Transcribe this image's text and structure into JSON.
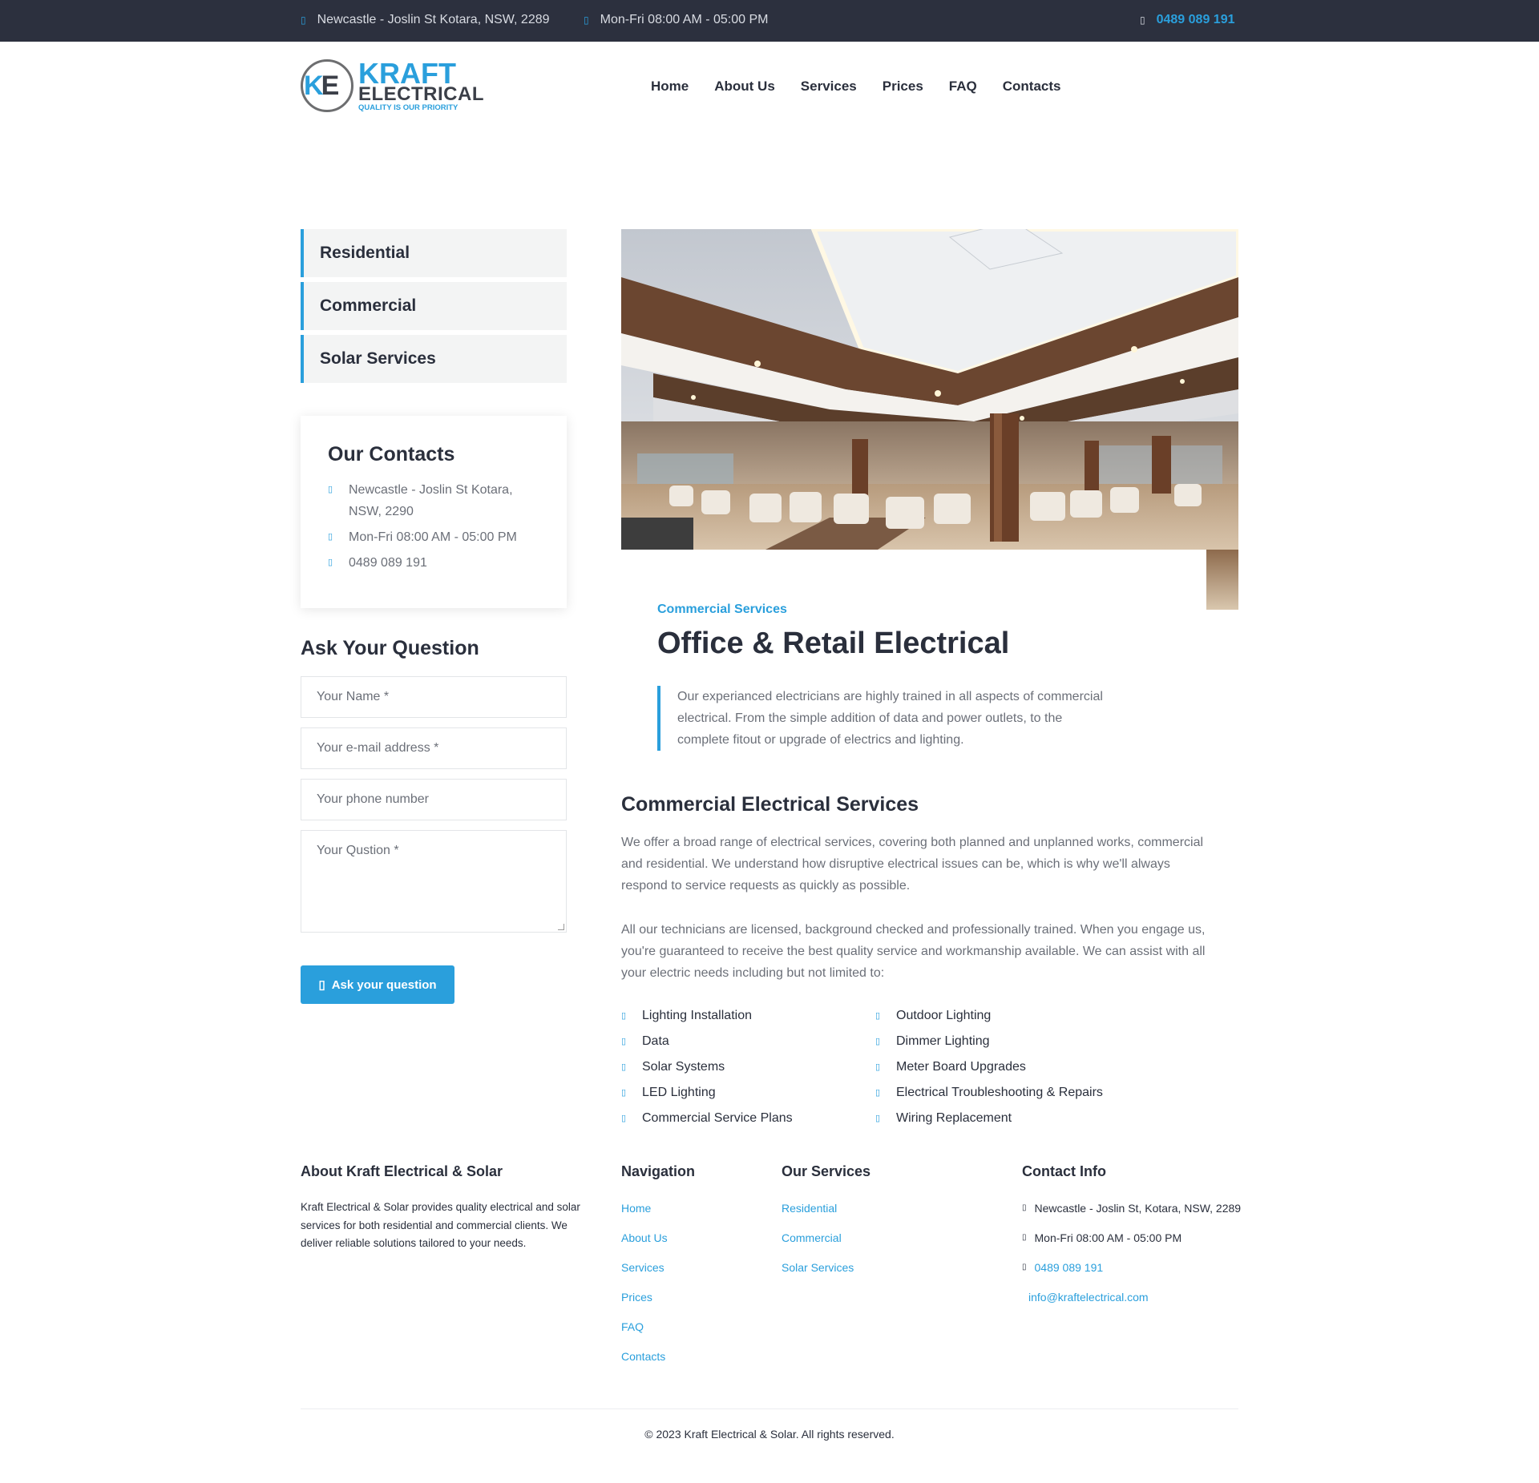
{
  "topbar": {
    "address": "Newcastle - Joslin St Kotara, NSW, 2289",
    "hours": "Mon-Fri 08:00 AM - 05:00 PM",
    "phone": "0489 089 191",
    "address_icon": "map-marker-icon",
    "hours_icon": "clock-icon",
    "phone_icon": "phone-icon"
  },
  "logo": {
    "brand": "KRAFT",
    "sub": "ELECTRICAL",
    "tagline": "QUALITY IS OUR PRIORITY",
    "monogram": "KE"
  },
  "nav": {
    "items": [
      "Home",
      "About Us",
      "Services",
      "Prices",
      "FAQ",
      "Contacts"
    ]
  },
  "sidebar": {
    "items": [
      "Residential",
      "Commercial",
      "Solar Services"
    ],
    "contacts": {
      "title": "Our Contacts",
      "address": "Newcastle - Joslin St Kotara, NSW, 2290",
      "hours": "Mon-Fri 08:00 AM - 05:00 PM",
      "phone": "0489 089 191"
    },
    "form": {
      "title": "Ask Your Question",
      "name_placeholder": "Your Name *",
      "email_placeholder": "Your e-mail address *",
      "phone_placeholder": "Your phone number",
      "question_placeholder": "Your Qustion *",
      "button": "Ask your question"
    }
  },
  "main": {
    "category": "Commercial Services",
    "title": "Office & Retail Electrical",
    "quote": "Our experianced electricians are highly trained in all aspects of commercial electrical. From the simple addition of data and power outlets, to the complete fitout or upgrade of electrics and lighting.",
    "section_title": "Commercial Electrical Services",
    "para1": "We offer a broad range of electrical services, covering both planned and unplanned works, commercial and residential. We understand how disruptive electrical issues can be, which is why we'll always respond to service requests as quickly as possible.",
    "para2": "All our technicians are licensed, background checked and professionally trained. When you engage us, you're guaranteed to receive the best quality service and workmanship available. We can assist with all your electric needs including but not limited to:",
    "services_left": [
      "Lighting Installation",
      "Data",
      "Solar Systems",
      "LED Lighting",
      "Commercial Service Plans"
    ],
    "services_right": [
      "Outdoor Lighting",
      "Dimmer Lighting",
      "Meter Board Upgrades",
      "Electrical Troubleshooting & Repairs",
      "Wiring Replacement"
    ]
  },
  "footer": {
    "about_title": "About Kraft Electrical & Solar",
    "about_text": "Kraft Electrical & Solar provides quality electrical and solar services for both residential and commercial clients. We deliver reliable solutions tailored to your needs.",
    "nav_title": "Navigation",
    "nav_links": [
      "Home",
      "About Us",
      "Services",
      "Prices",
      "FAQ",
      "Contacts"
    ],
    "services_title": "Our Services",
    "service_links": [
      "Residential",
      "Commercial",
      "Solar Services"
    ],
    "contact_title": "Contact Info",
    "contact_address": "Newcastle - Joslin St, Kotara, NSW, 2289",
    "contact_hours": "Mon-Fri 08:00 AM - 05:00 PM",
    "contact_phone": "0489 089 191",
    "contact_email": "info@kraftelectrical.com",
    "copyright": "© 2023 Kraft Electrical & Solar. All rights reserved."
  },
  "colors": {
    "accent": "#2a9fdc",
    "dark": "#2c303e",
    "text": "#2a2f3c",
    "muted": "#6b6f78"
  }
}
